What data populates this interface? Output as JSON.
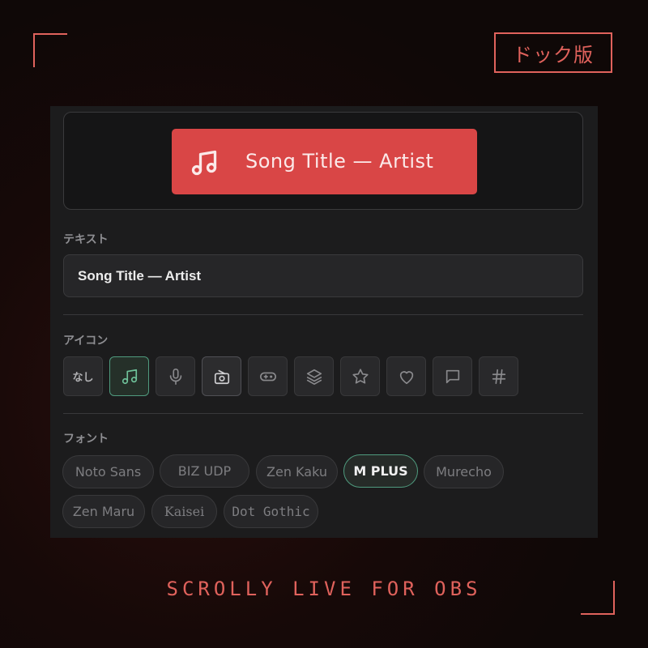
{
  "badge": "ドック版",
  "preview": {
    "text": "Song Title — Artist",
    "icon": "music-note-icon",
    "accent": "#d94646"
  },
  "text_section": {
    "label": "テキスト",
    "value": "Song Title — Artist"
  },
  "icon_section": {
    "label": "アイコン",
    "items": [
      {
        "label": "なし",
        "icon": "none"
      },
      {
        "icon": "music-note-icon",
        "selected": true
      },
      {
        "icon": "microphone-icon"
      },
      {
        "icon": "radio-icon"
      },
      {
        "icon": "gamepad-icon"
      },
      {
        "icon": "layers-icon"
      },
      {
        "icon": "star-icon"
      },
      {
        "icon": "heart-icon"
      },
      {
        "icon": "chat-bubble-icon"
      },
      {
        "icon": "hash-icon"
      }
    ]
  },
  "font_section": {
    "label": "フォント",
    "chips": [
      "Noto Sans",
      "BIZ UDP",
      "Zen Kaku",
      "M PLUS",
      "Murecho",
      "Zen Maru",
      "Kaisei",
      "Dot Gothic"
    ],
    "selected": "M PLUS"
  },
  "footer": "SCROLLY LIVE FOR OBS",
  "colors": {
    "accent_red": "#e0625c",
    "selected_green": "#4f9b7e",
    "panel_bg": "#1c1c1d"
  }
}
